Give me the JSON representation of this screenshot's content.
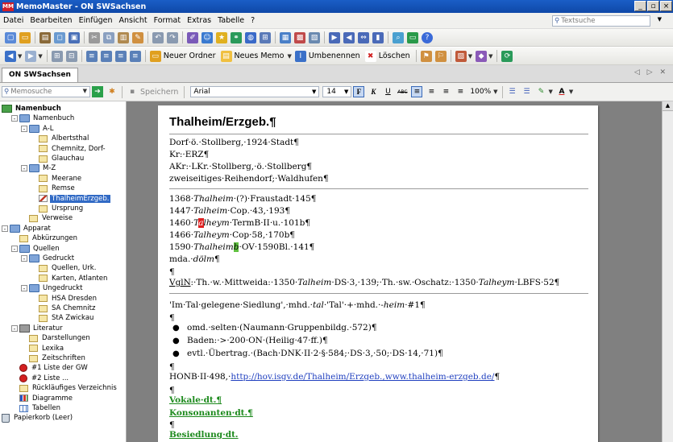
{
  "window": {
    "title": "MemoMaster - ON SWSachsen",
    "logo": "MM"
  },
  "menu": [
    "Datei",
    "Bearbeiten",
    "Einfügen",
    "Ansicht",
    "Format",
    "Extras",
    "Tabelle",
    "?"
  ],
  "search": {
    "placeholder": "Textsuche"
  },
  "toolbar3": {
    "new_folder": "Neuer Ordner",
    "new_memo": "Neues Memo",
    "rename": "Umbenennen",
    "delete": "Löschen"
  },
  "tab": {
    "label": "ON SWSachsen"
  },
  "editbar": {
    "memo_search": "Memosuche",
    "save": "Speichern",
    "font": "Arial",
    "size": "14",
    "zoom": "100%"
  },
  "tree": [
    {
      "label": "Namenbuch",
      "level": 0,
      "icon": "book",
      "bold": true
    },
    {
      "label": "Namenbuch",
      "level": 1,
      "icon": "folder",
      "exp": "-"
    },
    {
      "label": "A-L",
      "level": 2,
      "icon": "folder",
      "exp": "-"
    },
    {
      "label": "Albertsthal",
      "level": 3,
      "icon": "memo"
    },
    {
      "label": "Chemnitz, Dorf-",
      "level": 3,
      "icon": "memo"
    },
    {
      "label": "Glauchau",
      "level": 3,
      "icon": "memo"
    },
    {
      "label": "M-Z",
      "level": 2,
      "icon": "folder",
      "exp": "-"
    },
    {
      "label": "Meerane",
      "level": 3,
      "icon": "memo"
    },
    {
      "label": "Remse",
      "level": 3,
      "icon": "memo"
    },
    {
      "label": "ThalheimErzgeb.",
      "level": 3,
      "icon": "pen",
      "selected": true
    },
    {
      "label": "Ursprung",
      "level": 3,
      "icon": "memo"
    },
    {
      "label": "Verweise",
      "level": 2,
      "icon": "memo"
    },
    {
      "label": "Apparat",
      "level": 0,
      "icon": "folder",
      "exp": "-"
    },
    {
      "label": "Abkürzungen",
      "level": 1,
      "icon": "memo"
    },
    {
      "label": "Quellen",
      "level": 1,
      "icon": "folder",
      "exp": "-"
    },
    {
      "label": "Gedruckt",
      "level": 2,
      "icon": "folder",
      "exp": "-"
    },
    {
      "label": "Quellen, Urk.",
      "level": 3,
      "icon": "memo"
    },
    {
      "label": "Karten, Atlanten",
      "level": 3,
      "icon": "memo"
    },
    {
      "label": "Ungedruckt",
      "level": 2,
      "icon": "folder",
      "exp": "-"
    },
    {
      "label": "HSA Dresden",
      "level": 3,
      "icon": "memo"
    },
    {
      "label": "SA Chemnitz",
      "level": 3,
      "icon": "memo"
    },
    {
      "label": "StA Zwickau",
      "level": 3,
      "icon": "memo"
    },
    {
      "label": "Literatur",
      "level": 1,
      "icon": "lit",
      "exp": "-"
    },
    {
      "label": "Darstellungen",
      "level": 2,
      "icon": "memo"
    },
    {
      "label": "Lexika",
      "level": 2,
      "icon": "memo"
    },
    {
      "label": "Zeitschriften",
      "level": 2,
      "icon": "memo"
    },
    {
      "label": "#1 Liste der GW",
      "level": 1,
      "icon": "pin"
    },
    {
      "label": "#2 Liste ...",
      "level": 1,
      "icon": "pin"
    },
    {
      "label": "Rückläufiges Verzeichnis",
      "level": 1,
      "icon": "memo"
    },
    {
      "label": "Diagramme",
      "level": 1,
      "icon": "chart"
    },
    {
      "label": "Tabellen",
      "level": 1,
      "icon": "table"
    },
    {
      "label": "Papierkorb (Leer)",
      "level": 0,
      "icon": "bin"
    }
  ],
  "doc": {
    "title": "Thalheim/Erzgeb.¶",
    "header_lines": [
      "Dorf·ö.·Stollberg,·1924·Stadt¶",
      "Kr:·ERZ¶",
      "AKr:·LKr.·Stollberg,·ö.·Stollberg¶",
      "zweiseitiges·Reihendorf;·Waldhufen¶"
    ],
    "h1368_a": "1368·",
    "h1368_b": "Thalheim",
    "h1368_c": "·(?)·Fraustadt·145¶",
    "h1447_a": "1447·",
    "h1447_b": "Talheim",
    "h1447_c": "·Cop.·43,·193¶",
    "h1460_a": "1460·",
    "h1460_b": "T",
    "h1460_hl": "a",
    "h1460_c": "lheym",
    "h1460_d": "·TermB·II·u.·101b¶",
    "h1466_a": "1466·",
    "h1466_b": "Talheym",
    "h1466_c": "·Cop·58,·170b¶",
    "h1590_a": "1590·",
    "h1590_b": "Thalheim",
    "h1590_hl": "b",
    "h1590_c": "·OV·1590Bl.·141¶",
    "mda_a": "mda.·",
    "mda_b": "dölm",
    "mda_c": "¶",
    "pilcrow": "¶",
    "vgl_a": "VglN",
    "vgl_b": ":·Th.·w.·Mittweida:·1350·",
    "vgl_c": "Talheim",
    "vgl_d": "·DS·3,·139;·Th.·sw.·Oschatz:·1350·",
    "vgl_e": "Talheym",
    "vgl_f": "·LBFS·52¶",
    "meaning_a": "'Im·Tal·gelegene·Siedlung',·mhd.·",
    "meaning_b": "tal",
    "meaning_c": "·'Tal'·+·mhd.·-",
    "meaning_d": "heim",
    "meaning_e": "·#1¶",
    "bullets": [
      "omd.·selten·(Naumann·Gruppenbildg.·572)¶",
      "Baden:·>·200·ON·(Heilig·47·ff.)¶",
      "evtl.·Übertrag.·(Bach·DNK·II·2·§·584;·DS·3,·50;·DS·14,·71)¶"
    ],
    "honb_a": "HONB·II·498,·",
    "honb_link": "http://hov.isgv.de/Thalheim/Erzgeb.,www.thalheim-erzgeb.de/",
    "honb_c": "¶",
    "links": [
      "Vokale·dt.¶",
      "Konsonanten·dt.¶",
      "Besiedlung·dt."
    ]
  }
}
